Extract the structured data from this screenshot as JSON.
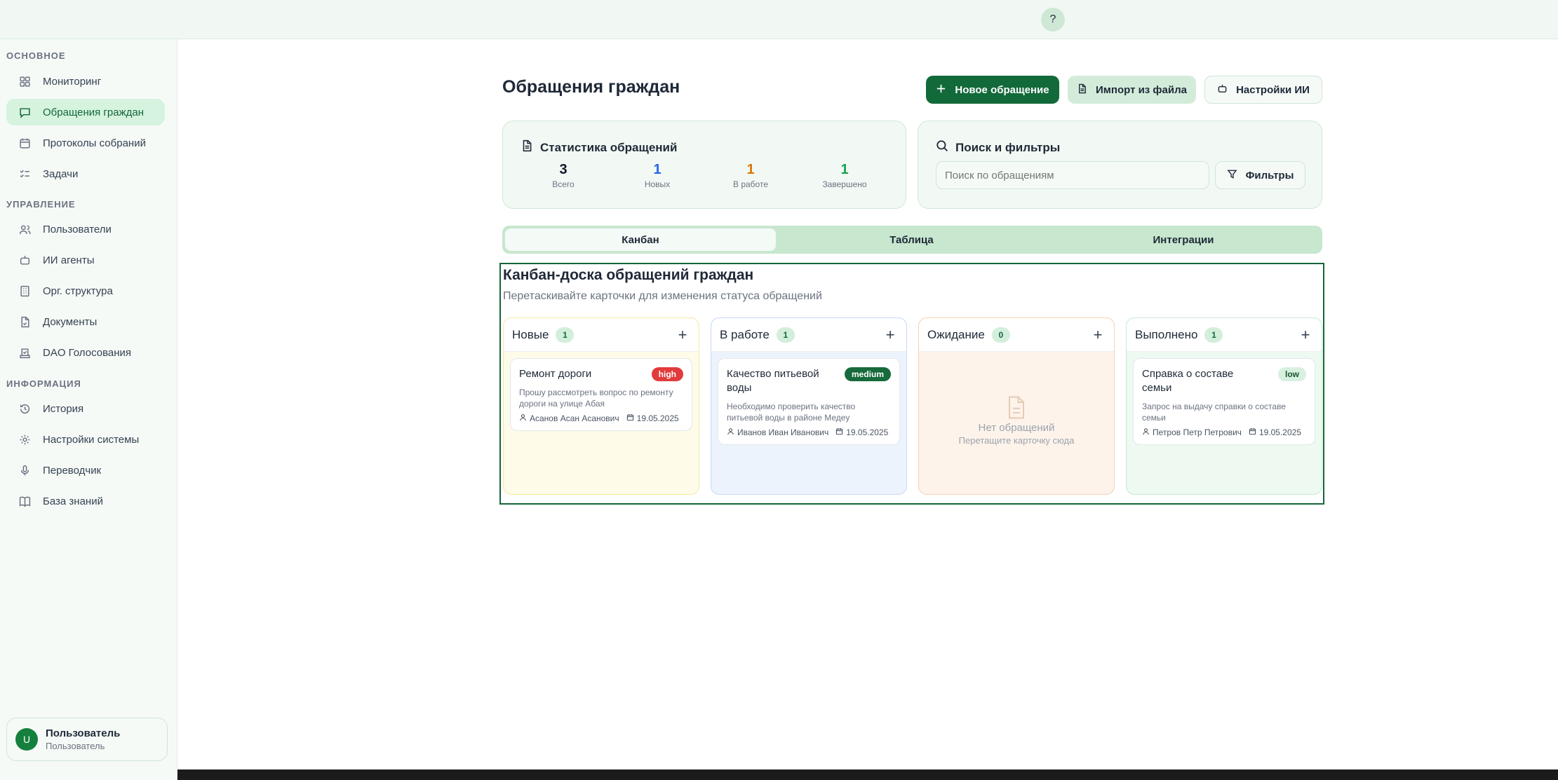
{
  "header": {
    "help_label": "?"
  },
  "sidebar": {
    "sections": [
      {
        "title": "ОСНОВНОЕ"
      },
      {
        "title": "УПРАВЛЕНИЕ"
      },
      {
        "title": "ИНФОРМАЦИЯ"
      }
    ],
    "items": [
      {
        "label": "Мониторинг",
        "icon": "dashboard-icon"
      },
      {
        "label": "Обращения граждан",
        "icon": "message-icon",
        "active": true
      },
      {
        "label": "Протоколы собраний",
        "icon": "calendar-icon"
      },
      {
        "label": "Задачи",
        "icon": "tasks-icon"
      },
      {
        "label": "Пользователи",
        "icon": "users-icon"
      },
      {
        "label": "ИИ агенты",
        "icon": "robot-icon"
      },
      {
        "label": "Орг. структура",
        "icon": "building-icon"
      },
      {
        "label": "Документы",
        "icon": "document-icon"
      },
      {
        "label": "DAO Голосования",
        "icon": "vote-icon"
      },
      {
        "label": "История",
        "icon": "history-icon"
      },
      {
        "label": "Настройки системы",
        "icon": "gear-icon"
      },
      {
        "label": "Переводчик",
        "icon": "microphone-icon"
      },
      {
        "label": "База знаний",
        "icon": "book-icon"
      }
    ],
    "user": {
      "avatar_letter": "U",
      "name": "Пользователь",
      "role": "Пользователь"
    }
  },
  "page": {
    "title": "Обращения граждан",
    "actions": {
      "new_label": "Новое обращение",
      "import_label": "Импорт из файла",
      "ai_settings_label": "Настройки ИИ"
    }
  },
  "stats": {
    "title": "Статистика обращений",
    "items": [
      {
        "value": "3",
        "label": "Всего",
        "color": "#111827"
      },
      {
        "value": "1",
        "label": "Новых",
        "color": "#2563eb"
      },
      {
        "value": "1",
        "label": "В работе",
        "color": "#d97706"
      },
      {
        "value": "1",
        "label": "Завершено",
        "color": "#16a34a"
      }
    ]
  },
  "search": {
    "title": "Поиск и фильтры",
    "placeholder": "Поиск по обращениям",
    "filters_label": "Фильтры"
  },
  "tabs": [
    {
      "label": "Канбан",
      "active": true
    },
    {
      "label": "Таблица"
    },
    {
      "label": "Интеграции"
    }
  ],
  "board": {
    "title": "Канбан-доска обращений граждан",
    "subtitle": "Перетаскивайте карточки для изменения статуса обращений",
    "columns": [
      {
        "title": "Новые",
        "count": "1",
        "bg": "#fefbe8",
        "border": "#f7e9a6",
        "cards": [
          {
            "title": "Ремонт дороги",
            "priority": "high",
            "desc": "Прошу рассмотреть вопрос по ремонту дороги на улице Абая",
            "author": "Асанов Асан Асанович",
            "date": "19.05.2025"
          }
        ]
      },
      {
        "title": "В работе",
        "count": "1",
        "bg": "#ecf3fd",
        "border": "#c7daf6",
        "cards": [
          {
            "title": "Качество питьевой воды",
            "priority": "medium",
            "desc": "Необходимо проверить качество питьевой воды в районе Медеу",
            "author": "Иванов Иван Иванович",
            "date": "19.05.2025"
          }
        ]
      },
      {
        "title": "Ожидание",
        "count": "0",
        "bg": "#fdf3ea",
        "border": "#f6d3b4",
        "cards": [],
        "empty_title": "Нет обращений",
        "empty_sub": "Перетащите карточку сюда"
      },
      {
        "title": "Выполнено",
        "count": "1",
        "bg": "#edf9f1",
        "border": "#c7ead2",
        "cards": [
          {
            "title": "Справка о составе семьи",
            "priority": "low",
            "desc": "Запрос на выдачу справки о составе семьи",
            "author": "Петров Петр Петрович",
            "date": "19.05.2025"
          }
        ]
      }
    ]
  }
}
